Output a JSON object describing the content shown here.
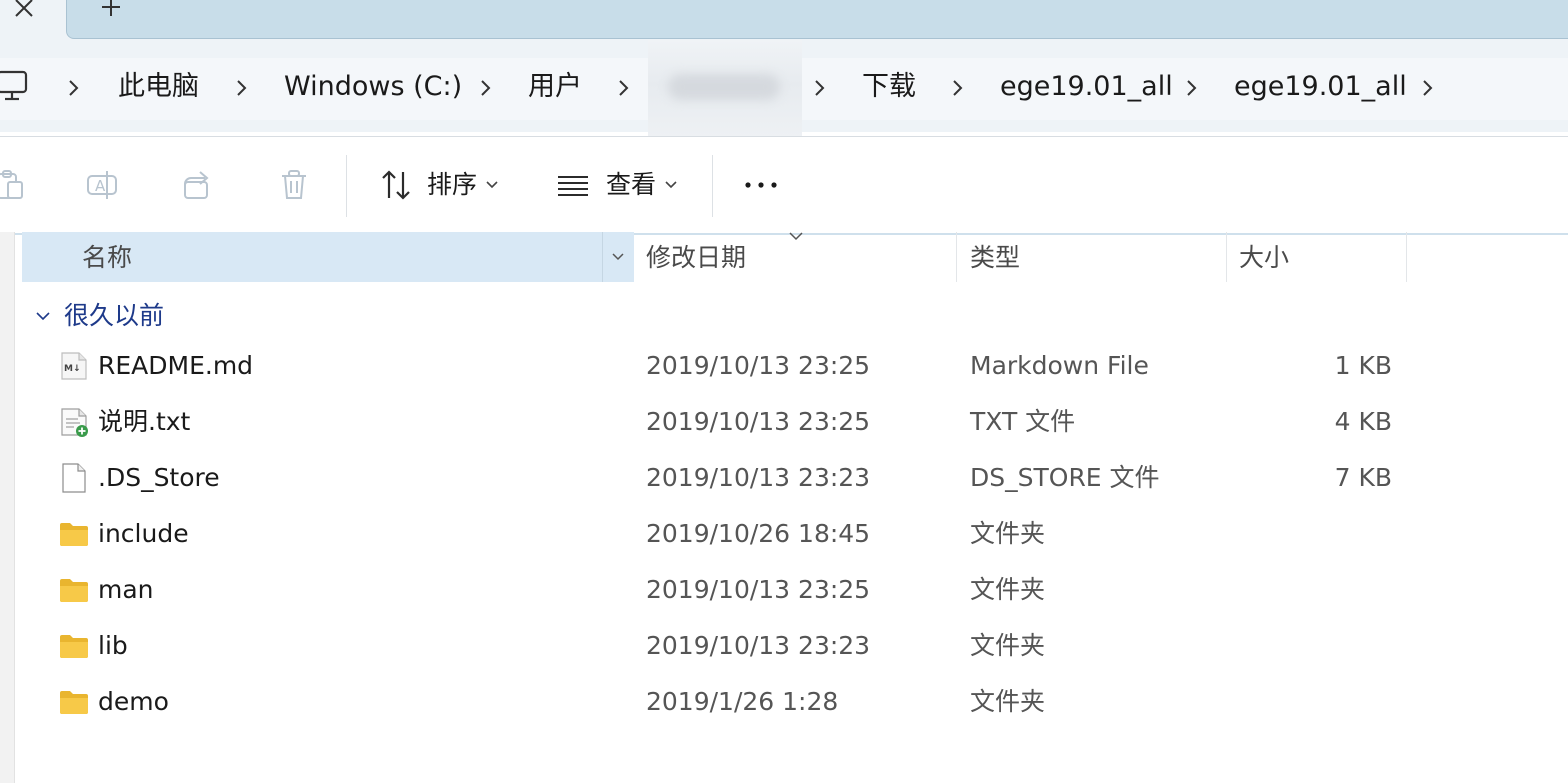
{
  "breadcrumbs": [
    {
      "label": "此电脑"
    },
    {
      "label": "Windows (C:)"
    },
    {
      "label": "用户"
    },
    {
      "label": ""
    },
    {
      "label": "下载"
    },
    {
      "label": "ege19.01_all"
    },
    {
      "label": "ege19.01_all"
    }
  ],
  "toolbar": {
    "sort_label": "排序",
    "view_label": "查看"
  },
  "columns": {
    "name": "名称",
    "modified": "修改日期",
    "type": "类型",
    "size": "大小"
  },
  "group": {
    "label": "很久以前"
  },
  "files": [
    {
      "name": "README.md",
      "modified": "2019/10/13 23:25",
      "type": "Markdown File",
      "size": "1 KB",
      "icon": "markdown-file-icon"
    },
    {
      "name": "说明.txt",
      "modified": "2019/10/13 23:25",
      "type": "TXT 文件",
      "size": "4 KB",
      "icon": "text-file-icon"
    },
    {
      "name": ".DS_Store",
      "modified": "2019/10/13 23:23",
      "type": "DS_STORE 文件",
      "size": "7 KB",
      "icon": "blank-file-icon"
    },
    {
      "name": "include",
      "modified": "2019/10/26 18:45",
      "type": "文件夹",
      "size": "",
      "icon": "folder-icon"
    },
    {
      "name": "man",
      "modified": "2019/10/13 23:25",
      "type": "文件夹",
      "size": "",
      "icon": "folder-icon"
    },
    {
      "name": "lib",
      "modified": "2019/10/13 23:23",
      "type": "文件夹",
      "size": "",
      "icon": "folder-icon"
    },
    {
      "name": "demo",
      "modified": "2019/1/26 1:28",
      "type": "文件夹",
      "size": "",
      "icon": "folder-icon"
    }
  ],
  "colors": {
    "accent": "#d8e8f5",
    "group_text": "#1e3a8a",
    "folder": "#f7c948"
  }
}
